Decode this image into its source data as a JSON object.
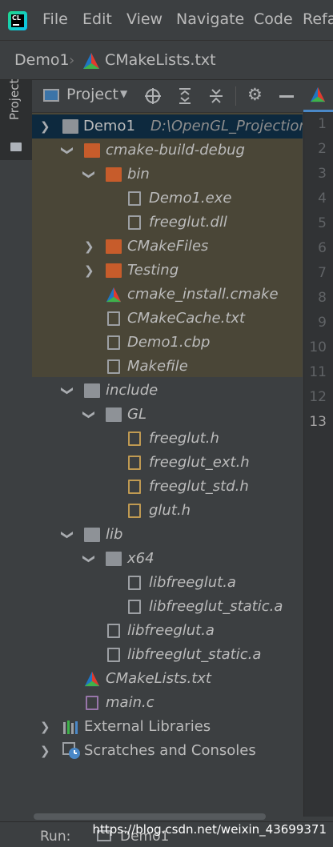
{
  "menu": {
    "items": [
      "File",
      "Edit",
      "View",
      "Navigate",
      "Code",
      "Refa"
    ]
  },
  "breadcrumb": {
    "project": "Demo1",
    "file": "CMakeLists.txt"
  },
  "sidebar": {
    "tab_label": "Project"
  },
  "toolbar": {
    "view_label": "Project"
  },
  "tree": {
    "root_label": "Demo1",
    "root_path": "D:\\OpenGL_Projection",
    "items": [
      {
        "label": "cmake-build-debug"
      },
      {
        "label": "bin"
      },
      {
        "label": "Demo1.exe"
      },
      {
        "label": "freeglut.dll"
      },
      {
        "label": "CMakeFiles"
      },
      {
        "label": "Testing"
      },
      {
        "label": "cmake_install.cmake"
      },
      {
        "label": "CMakeCache.txt"
      },
      {
        "label": "Demo1.cbp"
      },
      {
        "label": "Makefile"
      },
      {
        "label": "include"
      },
      {
        "label": "GL"
      },
      {
        "label": "freeglut.h"
      },
      {
        "label": "freeglut_ext.h"
      },
      {
        "label": "freeglut_std.h"
      },
      {
        "label": "glut.h"
      },
      {
        "label": "lib"
      },
      {
        "label": "x64"
      },
      {
        "label": "libfreeglut.a"
      },
      {
        "label": "libfreeglut_static.a"
      },
      {
        "label": "libfreeglut.a"
      },
      {
        "label": "libfreeglut_static.a"
      },
      {
        "label": "CMakeLists.txt"
      },
      {
        "label": "main.c"
      },
      {
        "label": "External Libraries"
      },
      {
        "label": "Scratches and Consoles"
      }
    ]
  },
  "gutter": {
    "line_numbers": [
      "1",
      "2",
      "3",
      "4",
      "5",
      "6",
      "7",
      "8",
      "9",
      "10",
      "11",
      "12",
      "13"
    ]
  },
  "bottom": {
    "run_label": "Run:",
    "run_config": "Demo1"
  },
  "watermark": "https://blog.csdn.net/weixin_43699371",
  "colors": {
    "background": "#3c3f41",
    "selection": "#0d293e",
    "excluded_highlight": "#4a4637",
    "folder_orange": "#c75c2b"
  }
}
